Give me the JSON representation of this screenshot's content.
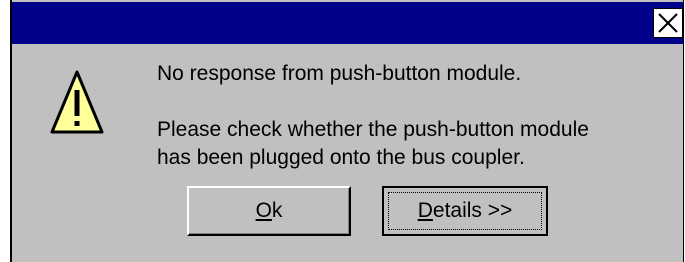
{
  "dialog": {
    "close_glyph": "✕",
    "message_line1": "No response from push-button module.",
    "message_line2": "Please check whether the push-button module",
    "message_line3": "has been plugged onto the bus coupler.",
    "icon": "warning-icon",
    "buttons": {
      "ok_accel": "O",
      "ok_rest": "k",
      "details_accel": "D",
      "details_rest": "etails >>"
    }
  },
  "colors": {
    "titlebar": "#00008b",
    "face": "#c0c0c0",
    "icon_fill": "#ffff99"
  }
}
